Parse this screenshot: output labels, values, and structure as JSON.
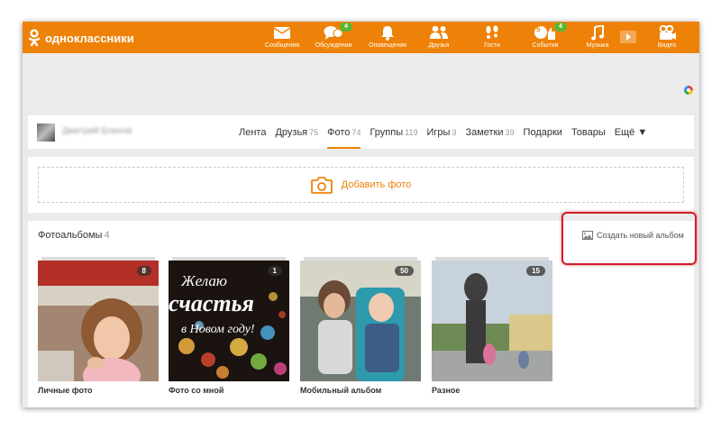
{
  "header": {
    "logo_text": "одноклассники",
    "nav": [
      {
        "label": "Сообщения",
        "icon": "envelope-icon",
        "badge": ""
      },
      {
        "label": "Обсуждения",
        "icon": "chat-icon",
        "badge": "4"
      },
      {
        "label": "Оповещения",
        "icon": "bell-icon",
        "badge": ""
      },
      {
        "label": "Друзья",
        "icon": "friends-icon",
        "badge": ""
      },
      {
        "label": "Гости",
        "icon": "footprints-icon",
        "badge": ""
      },
      {
        "label": "События",
        "icon": "events-icon",
        "badge": "4",
        "badge2": "5"
      },
      {
        "label": "Музыка",
        "icon": "music-note-icon",
        "badge": ""
      },
      {
        "label": "Видео",
        "icon": "video-camera-icon",
        "badge": ""
      }
    ]
  },
  "profile": {
    "name": "Дмитрий Блинов",
    "tabs": [
      {
        "label": "Лента",
        "count": ""
      },
      {
        "label": "Друзья",
        "count": "75"
      },
      {
        "label": "Фото",
        "count": "74"
      },
      {
        "label": "Группы",
        "count": "119"
      },
      {
        "label": "Игры",
        "count": "3"
      },
      {
        "label": "Заметки",
        "count": "39"
      },
      {
        "label": "Подарки",
        "count": ""
      },
      {
        "label": "Товары",
        "count": ""
      },
      {
        "label": "Ещё ▼",
        "count": ""
      }
    ]
  },
  "add_photo": {
    "label": "Добавить фото"
  },
  "albums": {
    "title": "Фотоальбомы",
    "count": "4",
    "create_label": "Создать новый альбом",
    "items": [
      {
        "name": "Личные фото",
        "count": "8"
      },
      {
        "name": "Фото со мной",
        "count": "1",
        "overlay": [
          "Желаю",
          "счастья",
          "в Новом году!"
        ]
      },
      {
        "name": "Мобильный альбом",
        "count": "50"
      },
      {
        "name": "Разное",
        "count": "15"
      }
    ]
  },
  "colors": {
    "brand": "#ee8208",
    "badge": "#5ab72f",
    "highlight": "#d01f26"
  }
}
